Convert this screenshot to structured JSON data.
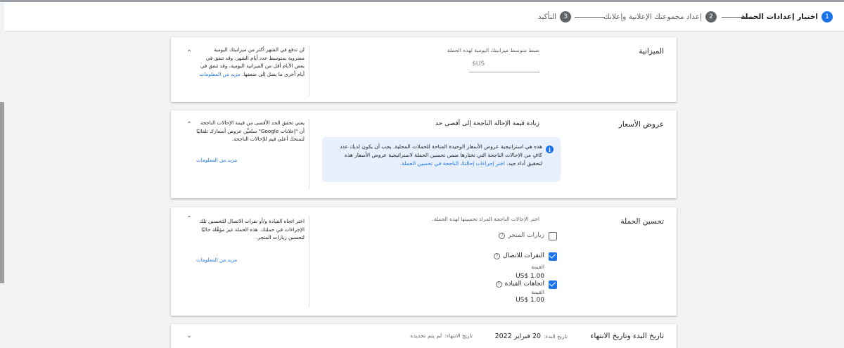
{
  "stepper": {
    "steps": [
      {
        "num": "1",
        "label": "اختيار إعدادات الحملة",
        "active": true
      },
      {
        "num": "2",
        "label": "إعداد مجموعتك الإعلانية وإعلانك",
        "active": false
      },
      {
        "num": "3",
        "label": "التأكيد",
        "active": false
      }
    ]
  },
  "budget": {
    "title": "الميزانية",
    "field_label": "ضبط متوسط ميزانيتك اليومية لهذه الحملة",
    "currency": "US$",
    "help": "لن تدفع في الشهر أكثر من ميزانيتك اليومية مضروبة بمتوسط عدد أيام الشهر. وقد تنفق في بعض الأيام أقل من الميزانية اليومية، وقد تنفق في أيام أخرى ما يصل إلى ضعفها.",
    "learn_more": "مزيد من المعلومات"
  },
  "bidding": {
    "title": "عروض الأسعار",
    "strategy": "زيادة قيمة الإحالة الناجحة إلى أقصى حد",
    "info": "هذه هي استراتيجية عروض الأسعار الوحيدة المتاحة للحملات المحلية. يجب أن يكون لديك عدد كافٍ من الإحالات الناجحة التي تختارها ضمن تحسين الحملة لاستراتيجية عروض الأسعار هذه لتحقيق أداء جيد.",
    "info_link": "اختر إجراءات إحالتك الناجحة في تحسين الحملة.",
    "help": "يعني تحقق الحد الأقصى من قيمة الإحالات الناجحة أن \"إعلانات Google\" ستُعيِّن عروض أسعارك تلقائيًا لتمنحك أعلى قيم للإحالات الناجحة.",
    "learn_more": "مزيد من المعلومات"
  },
  "optimization": {
    "title": "تحسين الحملة",
    "prompt": "اختر الإحالات الناجحة المراد تحسينها لهذه الحملة.",
    "options": [
      {
        "label": "زيارات المتجر",
        "checked": false
      },
      {
        "label": "النقرات للاتصال",
        "checked": true,
        "value_label": "القيمة",
        "value": "US$ 1.00"
      },
      {
        "label": "اتجاهات القيادة",
        "checked": true,
        "value_label": "القيمة",
        "value": "US$ 1.00"
      }
    ],
    "help": "اختر اتجاه القيادة و/أو نقرات الاتصال للتحسين تلك الإجراءات في حملتك. هذه الحملة غير مؤهَّلة حاليًا لتحسين زيارات المتجر.",
    "learn_more": "مزيد من المعلومات"
  },
  "dates": {
    "title": "تاريخ البدء وتاريخ الانتهاء",
    "start_label": "تاريخ البدء:",
    "start_value": "20 فبراير 2022",
    "end_label": "تاريخ الانتهاء:",
    "end_value": "لم يتم تحديده"
  }
}
